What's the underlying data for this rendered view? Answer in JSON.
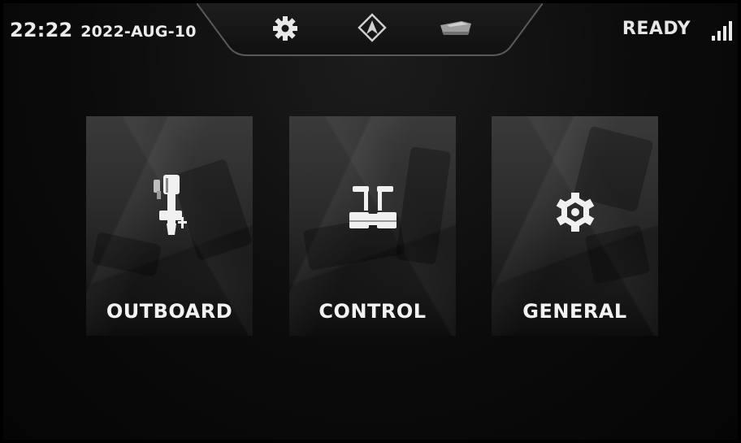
{
  "header": {
    "time": "22:22",
    "date": "2022-AUG-10",
    "status": "READY",
    "tabs": [
      {
        "name": "settings",
        "icon": "gear-icon"
      },
      {
        "name": "navigation",
        "icon": "navigation-arrow-icon"
      },
      {
        "name": "boat",
        "icon": "boat-icon"
      }
    ],
    "signal_icon": "signal-bars-icon"
  },
  "menu": {
    "cards": [
      {
        "label": "OUTBOARD",
        "icon": "outboard-motor-icon"
      },
      {
        "label": "CONTROL",
        "icon": "throttle-control-icon"
      },
      {
        "label": "GENERAL",
        "icon": "hex-gear-icon"
      }
    ]
  },
  "colors": {
    "background": "#0b0b0b",
    "text": "#ececec",
    "card": "#2e2e2e"
  }
}
